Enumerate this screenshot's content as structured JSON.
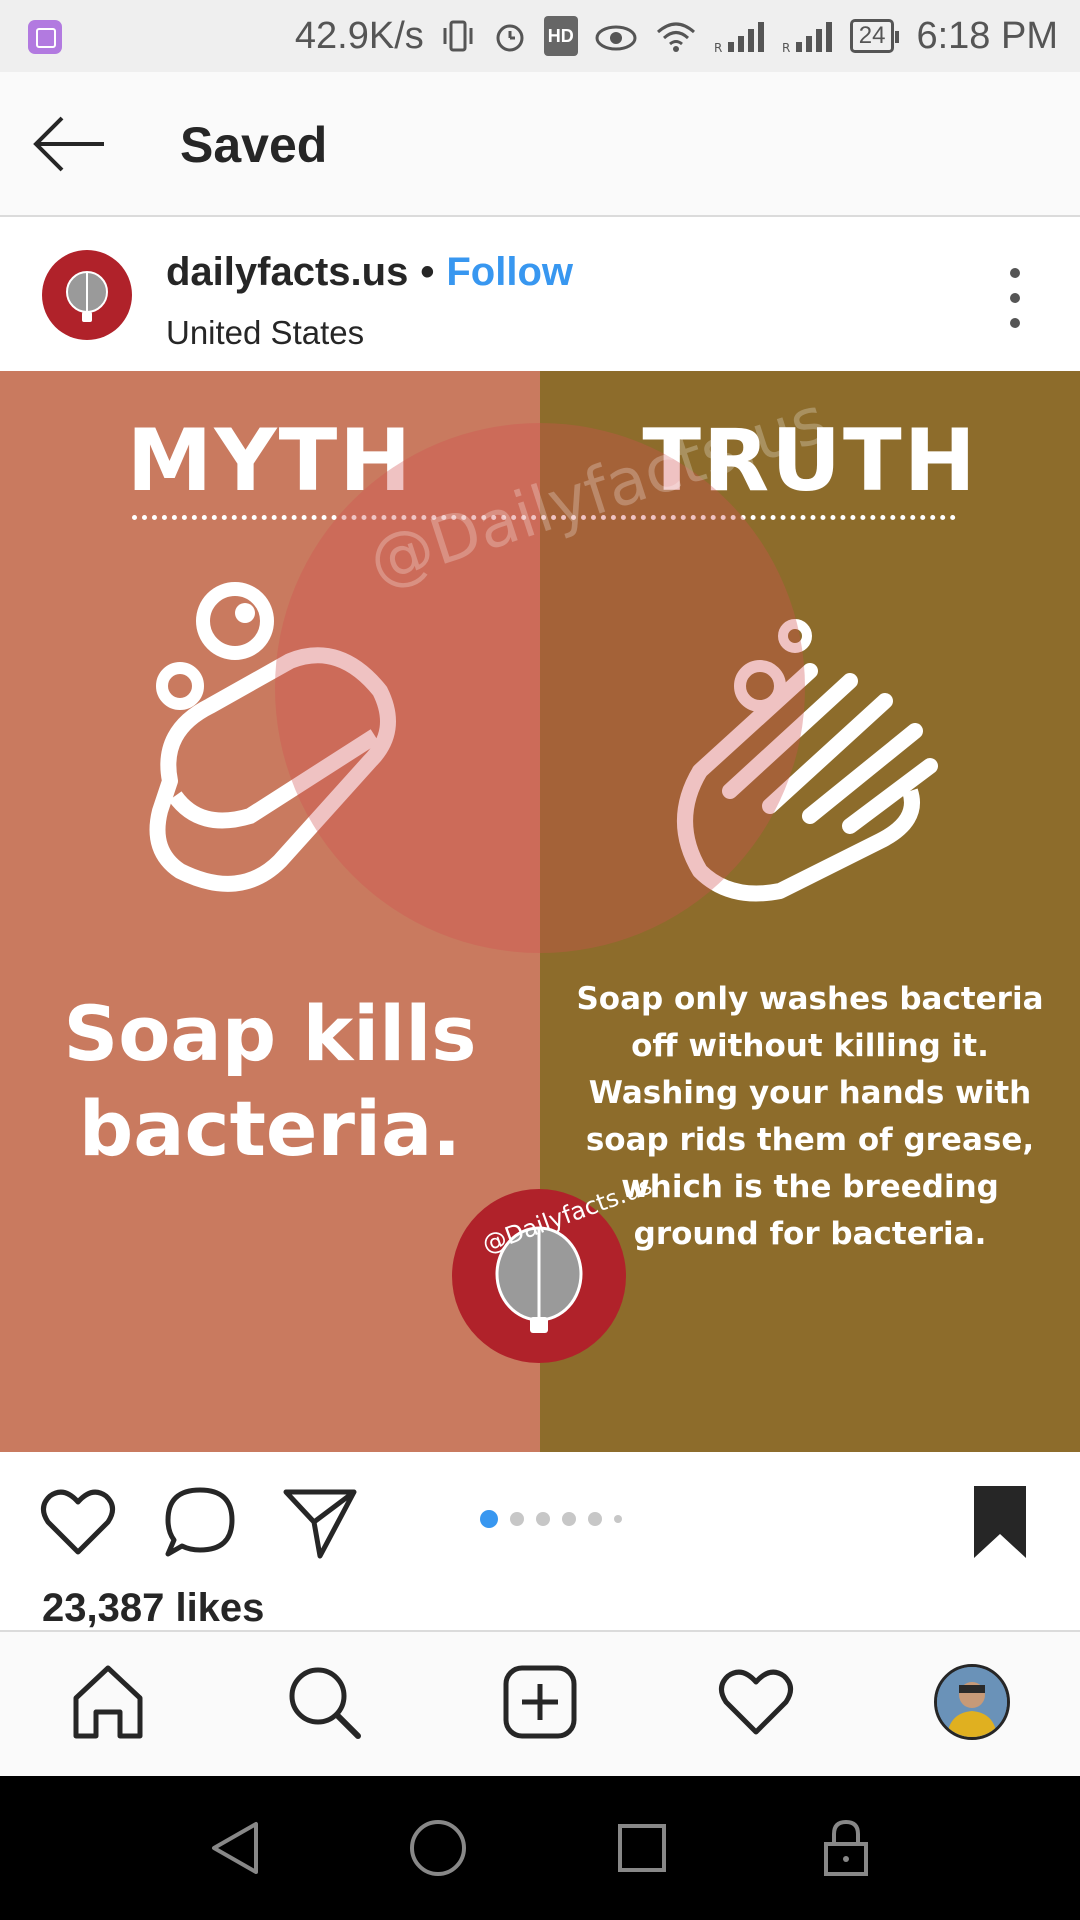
{
  "status_bar": {
    "net_speed": "42.9K/s",
    "hd_label": "HD",
    "battery": "24",
    "time": "6:18 PM",
    "icons": [
      "gallery-notification-icon",
      "vibrate-icon",
      "alarm-icon",
      "hd-icon",
      "eye-comfort-icon",
      "wifi-icon",
      "signal-icon",
      "signal-icon",
      "battery-icon"
    ]
  },
  "header": {
    "title": "Saved",
    "back_icon": "arrow-left-icon"
  },
  "post": {
    "username": "dailyfacts.us",
    "separator": "•",
    "follow_label": "Follow",
    "location": "United States",
    "image": {
      "myth_heading": "MYTH",
      "truth_heading": "TRUTH",
      "myth_text": "Soap kills bacteria.",
      "truth_text": "Soap only washes bacteria off without killing it. Washing your hands with soap rids them of grease, which is the breeding ground for bacteria.",
      "watermark": "@Dailyfacts.us",
      "left_color": "#c97a5f",
      "right_color": "#8d6c2b"
    },
    "carousel": {
      "count": 6,
      "active_index": 0
    },
    "likes": "23,387 likes"
  },
  "colors": {
    "accent": "#3897f0",
    "text": "#262626"
  },
  "bottom_nav": {
    "items": [
      "home-icon",
      "search-icon",
      "new-post-icon",
      "activity-heart-icon",
      "profile-avatar"
    ]
  },
  "system_nav": {
    "items": [
      "back-triangle-icon",
      "home-circle-icon",
      "recents-square-icon",
      "lock-icon"
    ]
  }
}
